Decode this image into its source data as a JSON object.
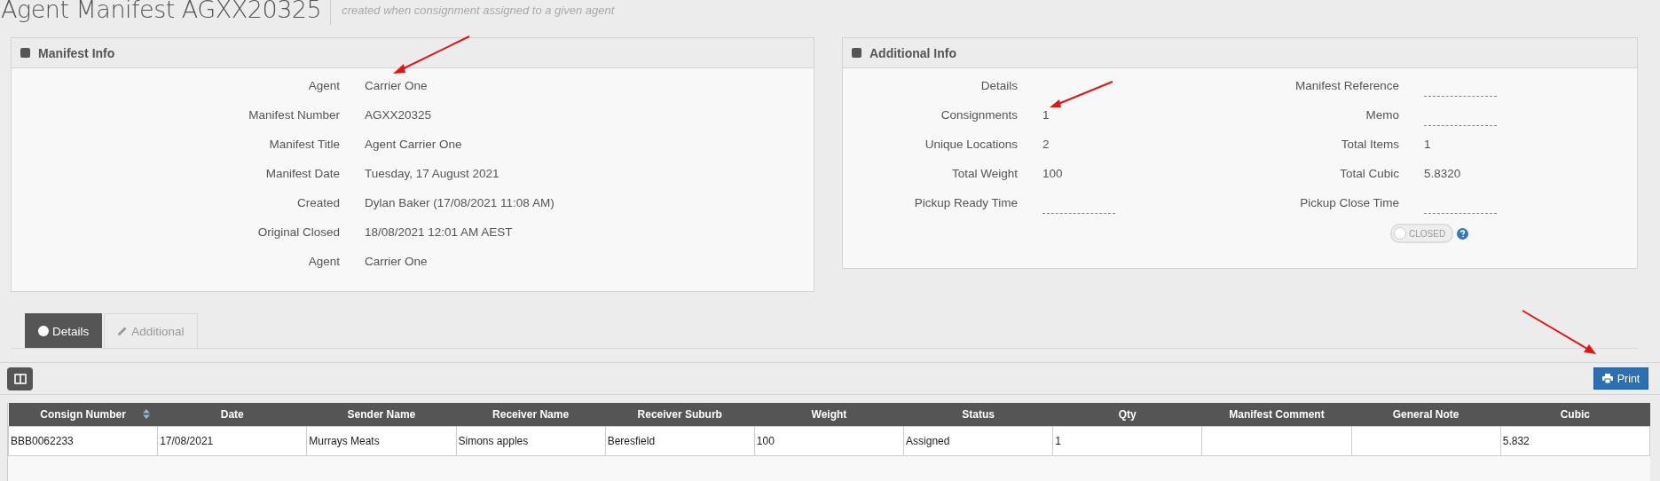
{
  "page": {
    "title": "Agent Manifest AGXX20325",
    "subtitle": "created when consignment assigned to a given agent"
  },
  "manifest_info": {
    "title": "Manifest Info",
    "rows": [
      {
        "label": "Agent",
        "value": "Carrier One"
      },
      {
        "label": "Manifest Number",
        "value": "AGXX20325"
      },
      {
        "label": "Manifest Title",
        "value": "Agent Carrier One"
      },
      {
        "label": "Manifest Date",
        "value": "Tuesday, 17 August 2021"
      },
      {
        "label": "Created",
        "value": "Dylan Baker (17/08/2021 11:08 AM)"
      },
      {
        "label": "Original Closed",
        "value": "18/08/2021 12:01 AM AEST"
      },
      {
        "label": "Agent",
        "value": "Carrier One"
      }
    ]
  },
  "additional_info": {
    "title": "Additional Info",
    "left": [
      {
        "label": "Details",
        "kind": "none"
      },
      {
        "label": "Consignments",
        "kind": "text",
        "value": "1"
      },
      {
        "label": "Unique Locations",
        "kind": "text",
        "value": "2"
      },
      {
        "label": "Total Weight",
        "kind": "text",
        "value": "100"
      },
      {
        "label": "Pickup Ready Time",
        "kind": "editable"
      }
    ],
    "right": [
      {
        "label": "Manifest Reference",
        "kind": "editable"
      },
      {
        "label": "Memo",
        "kind": "editable"
      },
      {
        "label": "Total Items",
        "kind": "text",
        "value": "1"
      },
      {
        "label": "Total Cubic",
        "kind": "text",
        "value": "5.8320"
      },
      {
        "label": "Pickup Close Time",
        "kind": "editable"
      }
    ],
    "closed_toggle": {
      "label": "CLOSED",
      "on": false
    }
  },
  "tabs": [
    {
      "label": "Details",
      "selected": true,
      "kind": "circle"
    },
    {
      "label": "Additional",
      "selected": false,
      "kind": "pencil"
    }
  ],
  "toolbar": {
    "print_button": "Print"
  },
  "table": {
    "columns": [
      {
        "label": "Consign Number",
        "sortable": true
      },
      {
        "label": "Date",
        "sortable": false
      },
      {
        "label": "Sender Name",
        "sortable": false
      },
      {
        "label": "Receiver Name",
        "sortable": false
      },
      {
        "label": "Receiver Suburb",
        "sortable": false
      },
      {
        "label": "Weight",
        "sortable": false
      },
      {
        "label": "Status",
        "sortable": false
      },
      {
        "label": "Qty",
        "sortable": false
      },
      {
        "label": "Manifest Comment",
        "sortable": false
      },
      {
        "label": "General Note",
        "sortable": false
      },
      {
        "label": "Cubic",
        "sortable": false
      }
    ],
    "rows": [
      [
        "BBB0062233",
        "17/08/2021",
        "Murrays Meats",
        "Simons apples",
        "Beresfield",
        "100",
        "Assigned",
        "1",
        "",
        "",
        "5.832"
      ]
    ]
  }
}
